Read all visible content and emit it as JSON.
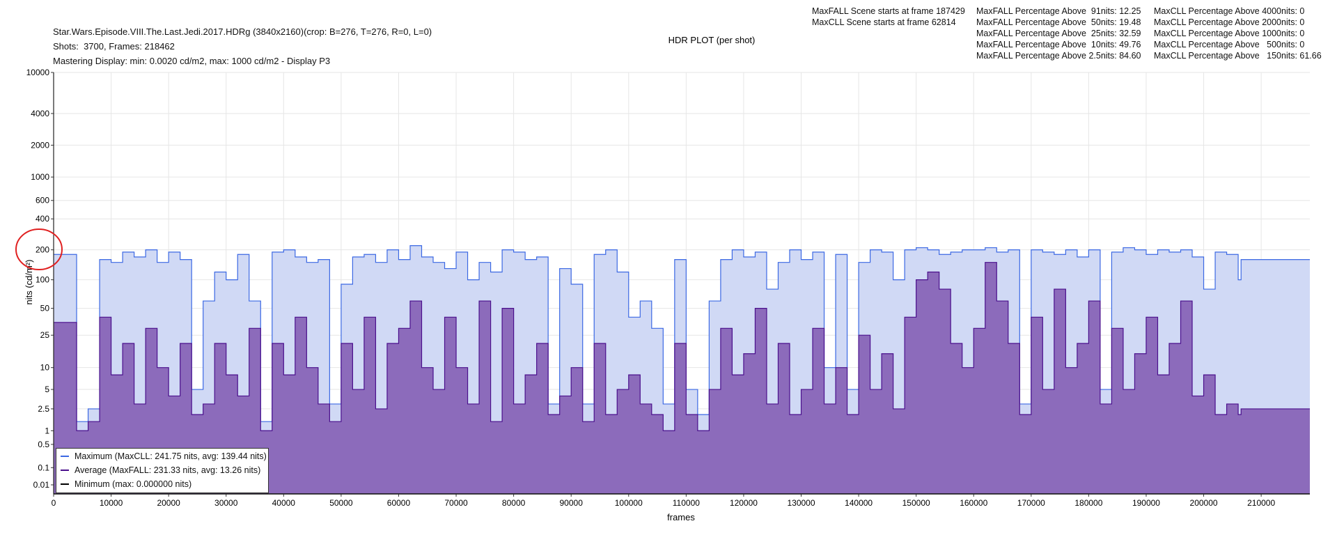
{
  "header": {
    "file_line": "Star.Wars.Episode.VIII.The.Last.Jedi.2017.HDRg (3840x2160)(crop: B=276, T=276, R=0, L=0)",
    "shots_line": "Shots:  3700, Frames: 218462",
    "mastering_line": "Mastering Display: min: 0.0020 cd/m2, max: 1000 cd/m2 - Display P3"
  },
  "stats": {
    "scene_lines": [
      "MaxFALL Scene starts at frame 187429",
      "MaxCLL Scene starts at frame 62814"
    ],
    "maxfall_lines": [
      "MaxFALL Percentage Above  91nits: 12.25",
      "MaxFALL Percentage Above  50nits: 19.48",
      "MaxFALL Percentage Above  25nits: 32.59",
      "MaxFALL Percentage Above  10nits: 49.76",
      "MaxFALL Percentage Above 2.5nits: 84.60"
    ],
    "maxcll_lines": [
      "MaxCLL Percentage Above 4000nits: 0",
      "MaxCLL Percentage Above 2000nits: 0",
      "MaxCLL Percentage Above 1000nits: 0",
      "MaxCLL Percentage Above   500nits: 0",
      "MaxCLL Percentage Above   150nits: 61.66"
    ]
  },
  "chart_data": {
    "type": "area",
    "title": "HDR PLOT (per shot)",
    "xlabel": "frames",
    "ylabel": "nits (cd/m²)",
    "y_scale": "PQ (SMPTE ST 2084)",
    "xlim": [
      0,
      218462
    ],
    "ylim": [
      0,
      10000
    ],
    "x_ticks": [
      "0",
      "10000",
      "20000",
      "30000",
      "40000",
      "50000",
      "60000",
      "70000",
      "80000",
      "90000",
      "100000",
      "110000",
      "120000",
      "130000",
      "140000",
      "150000",
      "160000",
      "170000",
      "180000",
      "190000",
      "200000",
      "210000"
    ],
    "y_ticks": [
      "0.01",
      "0.1",
      "0.5",
      "1",
      "2.5",
      "5",
      "10",
      "25",
      "50",
      "100",
      "200",
      "400",
      "600",
      "1000",
      "2000",
      "4000",
      "10000"
    ],
    "grid": true,
    "legend_position": "bottom-left",
    "legend": [
      "Maximum (MaxCLL: 241.75 nits, avg: 139.44 nits)",
      "Average (MaxFALL: 231.33 nits, avg: 13.26 nits)",
      "Minimum (max: 0.000000 nits)"
    ],
    "colors": {
      "maximum_line": "#3b68e3",
      "maximum_fill": "#d0d9f5",
      "average_line": "#4a0f8c",
      "average_fill": "#8c6bbb",
      "minimum_line": "#000000",
      "annotation": "#e02020"
    },
    "x": [
      0,
      2000,
      4000,
      6000,
      8000,
      10000,
      12000,
      14000,
      16000,
      18000,
      20000,
      22000,
      24000,
      26000,
      28000,
      30000,
      32000,
      34000,
      36000,
      38000,
      40000,
      42000,
      44000,
      46000,
      48000,
      50000,
      52000,
      54000,
      56000,
      58000,
      60000,
      62000,
      64000,
      66000,
      68000,
      70000,
      72000,
      74000,
      76000,
      78000,
      80000,
      82000,
      84000,
      86000,
      88000,
      90000,
      92000,
      94000,
      96000,
      98000,
      100000,
      102000,
      104000,
      106000,
      108000,
      110000,
      112000,
      114000,
      116000,
      118000,
      120000,
      122000,
      124000,
      126000,
      128000,
      130000,
      132000,
      134000,
      136000,
      138000,
      140000,
      142000,
      144000,
      146000,
      148000,
      150000,
      152000,
      154000,
      156000,
      158000,
      160000,
      162000,
      164000,
      166000,
      168000,
      170000,
      172000,
      174000,
      176000,
      178000,
      180000,
      182000,
      184000,
      186000,
      188000,
      190000,
      192000,
      194000,
      196000,
      198000,
      200000,
      202000,
      204000,
      206000,
      206500,
      218000
    ],
    "series": [
      {
        "name": "Maximum",
        "values": [
          180,
          180,
          1.5,
          2.5,
          160,
          150,
          190,
          170,
          200,
          150,
          190,
          160,
          5,
          60,
          120,
          100,
          180,
          60,
          1.5,
          190,
          200,
          170,
          150,
          160,
          3,
          90,
          170,
          180,
          150,
          200,
          160,
          220,
          170,
          150,
          130,
          190,
          100,
          150,
          120,
          200,
          190,
          160,
          170,
          3,
          130,
          90,
          3,
          180,
          200,
          120,
          40,
          60,
          30,
          3,
          160,
          5,
          2,
          60,
          160,
          200,
          170,
          190,
          80,
          150,
          200,
          160,
          190,
          10,
          180,
          5,
          150,
          200,
          190,
          100,
          200,
          210,
          200,
          180,
          190,
          200,
          200,
          210,
          190,
          200,
          3,
          200,
          190,
          180,
          200,
          170,
          200,
          5,
          190,
          210,
          200,
          180,
          200,
          190,
          200,
          170,
          80,
          190,
          180,
          100,
          160,
          160
        ]
      },
      {
        "name": "Average",
        "values": [
          35,
          35,
          1,
          1.5,
          40,
          8,
          20,
          3,
          30,
          10,
          4,
          20,
          2,
          3,
          20,
          8,
          4,
          30,
          1,
          20,
          8,
          40,
          10,
          3,
          1.5,
          20,
          5,
          40,
          2.5,
          20,
          30,
          60,
          10,
          5,
          40,
          10,
          3,
          60,
          1.5,
          50,
          3,
          8,
          20,
          2,
          4,
          10,
          1.5,
          20,
          2,
          5,
          8,
          3,
          2,
          1,
          20,
          2,
          1,
          5,
          30,
          8,
          15,
          50,
          3,
          20,
          2,
          5,
          30,
          3,
          10,
          2,
          25,
          5,
          15,
          2.5,
          40,
          100,
          120,
          80,
          20,
          10,
          30,
          150,
          60,
          20,
          2,
          40,
          5,
          80,
          10,
          20,
          60,
          3,
          30,
          5,
          15,
          40,
          8,
          20,
          60,
          4,
          8,
          2,
          3,
          2,
          2.5,
          2.5
        ]
      }
    ]
  }
}
